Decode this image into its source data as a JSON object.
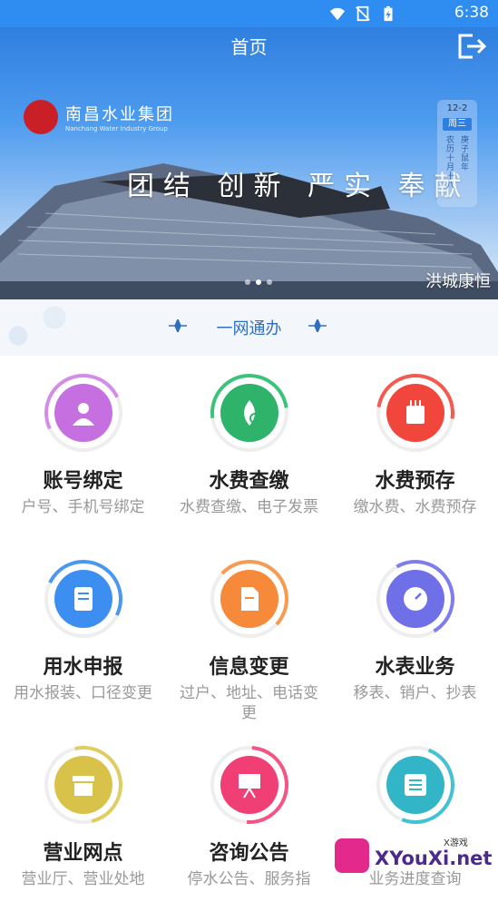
{
  "status": {
    "time": "6:38",
    "icons": [
      "wifi-icon",
      "no-sim-icon",
      "battery-charging-icon"
    ]
  },
  "header": {
    "title": "首页"
  },
  "banner": {
    "logo_cn": "南昌水业集团",
    "logo_en": "Nanchang Water Industry Group",
    "slogan": "团结 创新 严实 奉献",
    "calendar": {
      "date": "12-2",
      "weekday": "周三",
      "lunar": "农历十月十八",
      "year": "庚子鼠年"
    },
    "caption": "洪城康恒",
    "dots": 3,
    "active_dot": 1
  },
  "section": {
    "title": "一网通办"
  },
  "tiles": [
    {
      "title": "账号绑定",
      "subtitle": "户号、手机号绑定",
      "color": "#c56fe0",
      "ring": "#d58ce8",
      "icon": "account-bind-icon"
    },
    {
      "title": "水费查缴",
      "subtitle": "水费查缴、电子发票",
      "color": "#2fb36b",
      "ring": "#3bc37a",
      "icon": "water-fee-query-icon"
    },
    {
      "title": "水费预存",
      "subtitle": "缴水费、水费预存",
      "color": "#f0463c",
      "ring": "#f35a50",
      "icon": "water-fee-prepay-icon"
    },
    {
      "title": "用水申报",
      "subtitle": "用水报装、口径变更",
      "color": "#3c8ff0",
      "ring": "#4a98f2",
      "icon": "water-apply-icon"
    },
    {
      "title": "信息变更",
      "subtitle": "过户、地址、电话变更",
      "color": "#f6893a",
      "ring": "#f79a52",
      "icon": "info-change-icon"
    },
    {
      "title": "水表业务",
      "subtitle": "移表、销户、抄表",
      "color": "#6f6fe8",
      "ring": "#7d7df0",
      "icon": "water-meter-icon"
    },
    {
      "title": "营业网点",
      "subtitle": "营业厅、营业处地",
      "color": "#d9c24a",
      "ring": "#e0cd60",
      "icon": "service-outlet-icon"
    },
    {
      "title": "咨询公告",
      "subtitle": "停水公告、服务指",
      "color": "#f03f74",
      "ring": "#f35584",
      "icon": "announcement-icon"
    },
    {
      "title": "",
      "subtitle": "业务进度查询",
      "color": "#33b5c8",
      "ring": "#43c2d4",
      "icon": "progress-list-icon"
    }
  ],
  "watermark": {
    "text": "XYouXi.net",
    "top": "X游戏"
  }
}
